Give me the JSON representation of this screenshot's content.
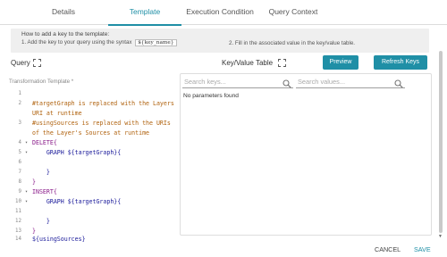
{
  "tabs": [
    {
      "label": "Details"
    },
    {
      "label": "Template"
    },
    {
      "label": "Execution Condition"
    },
    {
      "label": "Query Context"
    }
  ],
  "help": {
    "title": "How to add a key to the template:",
    "step1": "1. Add the key to your query using the syntax",
    "step1_code": "${key_name}",
    "step2": "2. Fill in the associated value in the key/value table."
  },
  "query": {
    "label": "Query"
  },
  "kv": {
    "label": "Key/Value Table",
    "search_keys_placeholder": "Search keys...",
    "search_values_placeholder": "Search values...",
    "empty_text": "No parameters found"
  },
  "buttons": {
    "preview": "Preview",
    "refresh": "Refresh Keys"
  },
  "template_label": "Transformation Template *",
  "code_lines": [
    {
      "n": "1",
      "fold": "",
      "text": ""
    },
    {
      "n": "2",
      "fold": "",
      "text": "#targetGraph is replaced with the Layers"
    },
    {
      "n": "",
      "fold": "",
      "text": "URI at runtime"
    },
    {
      "n": "3",
      "fold": "",
      "text": "#usingSources is replaced with the URIs"
    },
    {
      "n": "",
      "fold": "",
      "text": "of the Layer's Sources at runtime"
    },
    {
      "n": "4",
      "fold": "▾",
      "text": "DELETE{"
    },
    {
      "n": "5",
      "fold": "▾",
      "text": "    GRAPH ${targetGraph}{"
    },
    {
      "n": "6",
      "fold": "",
      "text": ""
    },
    {
      "n": "7",
      "fold": "",
      "text": "    }"
    },
    {
      "n": "8",
      "fold": "",
      "text": "}"
    },
    {
      "n": "9",
      "fold": "▾",
      "text": "INSERT{"
    },
    {
      "n": "10",
      "fold": "▾",
      "text": "    GRAPH ${targetGraph}{"
    },
    {
      "n": "11",
      "fold": "",
      "text": ""
    },
    {
      "n": "12",
      "fold": "",
      "text": "    }"
    },
    {
      "n": "13",
      "fold": "",
      "text": "}"
    },
    {
      "n": "14",
      "fold": "",
      "text": "${usingSources}"
    }
  ],
  "footer": {
    "cancel": "CANCEL",
    "save": "SAVE"
  },
  "colors": {
    "accent": "#1f8fa6",
    "comment": "#b0620e",
    "keyword": "#8a1c8a",
    "variable": "#1a1a9a"
  },
  "icons": {
    "expand": "expand-arrows-icon",
    "search": "search-icon"
  }
}
